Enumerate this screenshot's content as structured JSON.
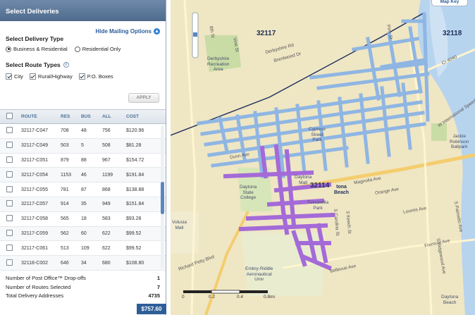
{
  "panel": {
    "title": "Select Deliveries",
    "hide_options": "Hide Mailing Options",
    "delivery_type": {
      "label": "Select Delivery Type",
      "options": [
        "Business & Residential",
        "Residential Only"
      ],
      "selected": "Business & Residential"
    },
    "route_types": {
      "label": "Select Route Types",
      "options": [
        "City",
        "Rural/Highway",
        "P.O. Boxes"
      ],
      "checked": [
        true,
        true,
        true
      ]
    },
    "apply_label": "APPLY"
  },
  "table": {
    "headers": [
      "ROUTE",
      "RES",
      "BUS",
      "ALL",
      "COST"
    ],
    "rows": [
      {
        "route": "32117-C047",
        "res": "708",
        "bus": "48",
        "all": "756",
        "cost": "$120.96"
      },
      {
        "route": "32117-C049",
        "res": "503",
        "bus": "5",
        "all": "508",
        "cost": "$81.28"
      },
      {
        "route": "32117-C051",
        "res": "879",
        "bus": "88",
        "all": "967",
        "cost": "$154.72"
      },
      {
        "route": "32117-C054",
        "res": "1153",
        "bus": "46",
        "all": "1199",
        "cost": "$191.84"
      },
      {
        "route": "32117-C055",
        "res": "781",
        "bus": "87",
        "all": "868",
        "cost": "$138.88"
      },
      {
        "route": "32117-C057",
        "res": "914",
        "bus": "35",
        "all": "949",
        "cost": "$151.84"
      },
      {
        "route": "32117-C058",
        "res": "565",
        "bus": "18",
        "all": "583",
        "cost": "$93.28"
      },
      {
        "route": "32117-C059",
        "res": "562",
        "bus": "60",
        "all": "622",
        "cost": "$99.52"
      },
      {
        "route": "32117-C061",
        "res": "513",
        "bus": "109",
        "all": "622",
        "cost": "$99.52"
      },
      {
        "route": "32118-C002",
        "res": "646",
        "bus": "34",
        "all": "680",
        "cost": "$108.80"
      }
    ]
  },
  "summary": {
    "post_office_label": "Number of Post Office™ Drop-offs",
    "post_office_value": "1",
    "routes_label": "Number of Routes Selected",
    "routes_value": "7",
    "addresses_label": "Total Delivery Addresses",
    "addresses_value": "4735",
    "total_cost": "$757.60"
  },
  "map": {
    "map_type_label": "Map Key",
    "zips": [
      "32117",
      "32118",
      "32114"
    ],
    "places": {
      "derbyshire": "Derbyshire\nRecreation\nArea",
      "cypress": "Cypress\nStreet\nPark",
      "daytona_mall": "Daytona\nMall",
      "dsc": "Daytona\nState\nCollege",
      "tuscawilla": "Tuscawilla\nPark",
      "volusia": "Volusia\nMall",
      "erau": "Embry-Riddle\nAeronautical\nUniv",
      "jackie": "Jackie\nRobinson\nBallpark",
      "daytona_beach": "tona\nBeach",
      "daytona_bottom": "Daytona\nBeach"
    },
    "streets": [
      "Vine St",
      "8th St",
      "Brentwood Dr",
      "Derbyshire Rd",
      "Pine St",
      "Orange Ave",
      "Magnolia Ave",
      "Loomis Ave",
      "Bellevue Ave",
      "Fremont Ave",
      "S Ridgewood Ave",
      "S Palmetto Ave",
      "Richard Petty Blvd",
      "W International Speedway Blvd",
      "S Keech St",
      "S Carolina St",
      "Dunn Ave",
      "Cr 4040"
    ],
    "scale": [
      "0",
      "0.2",
      "0.4",
      "0.8mi"
    ],
    "colors": {
      "selected_routes": "#8fb6e3",
      "highlight_route": "#a46ad8",
      "water": "#b7d4ef",
      "park": "#c9dca6"
    }
  }
}
